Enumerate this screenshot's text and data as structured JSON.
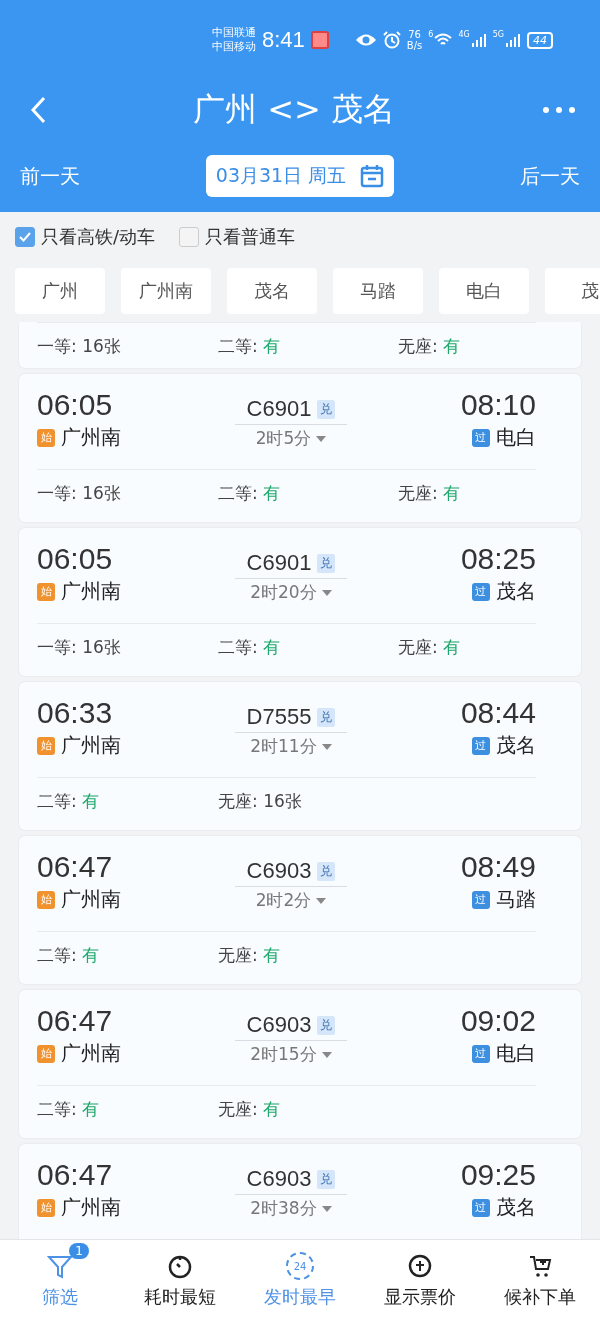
{
  "status_bar": {
    "carriers": [
      "中国联通",
      "中国移动"
    ],
    "time": "8:41",
    "speed": [
      "76",
      "B/s"
    ],
    "wifi_label": "6",
    "signal_labels": [
      "4G",
      "5G"
    ],
    "battery": "44"
  },
  "header": {
    "title": "广州 <> 茂名"
  },
  "date_bar": {
    "prev": "前一天",
    "date": "03月31日 周五",
    "next": "后一天"
  },
  "filters": [
    {
      "label": "只看高铁/动车",
      "checked": true
    },
    {
      "label": "只看普通车",
      "checked": false
    }
  ],
  "stations": [
    "广州",
    "广州南",
    "茂名",
    "马踏",
    "电白",
    "茂"
  ],
  "trains": [
    {
      "seats": [
        {
          "class": "一等: ",
          "value": "16张",
          "ample": false
        },
        {
          "class": "二等: ",
          "value": "有",
          "ample": true
        },
        {
          "class": "无座: ",
          "value": "有",
          "ample": true
        }
      ]
    },
    {
      "depart": "06:05",
      "from_badge": {
        "text": "始",
        "color": "#f0922e"
      },
      "from": "广州南",
      "number": "C6901",
      "tag": "兑",
      "duration": "2时5分",
      "arrive": "08:10",
      "to_badge": {
        "text": "过",
        "color": "#3d8fe0"
      },
      "to": "电白",
      "seats": [
        {
          "class": "一等: ",
          "value": "16张",
          "ample": false
        },
        {
          "class": "二等: ",
          "value": "有",
          "ample": true
        },
        {
          "class": "无座: ",
          "value": "有",
          "ample": true
        }
      ]
    },
    {
      "depart": "06:05",
      "from_badge": {
        "text": "始",
        "color": "#f0922e"
      },
      "from": "广州南",
      "number": "C6901",
      "tag": "兑",
      "duration": "2时20分",
      "arrive": "08:25",
      "to_badge": {
        "text": "过",
        "color": "#3d8fe0"
      },
      "to": "茂名",
      "seats": [
        {
          "class": "一等: ",
          "value": "16张",
          "ample": false
        },
        {
          "class": "二等: ",
          "value": "有",
          "ample": true
        },
        {
          "class": "无座: ",
          "value": "有",
          "ample": true
        }
      ]
    },
    {
      "depart": "06:33",
      "from_badge": {
        "text": "始",
        "color": "#f0922e"
      },
      "from": "广州南",
      "number": "D7555",
      "tag": "兑",
      "duration": "2时11分",
      "arrive": "08:44",
      "to_badge": {
        "text": "过",
        "color": "#3d8fe0"
      },
      "to": "茂名",
      "seats": [
        {
          "class": "二等: ",
          "value": "有",
          "ample": true
        },
        {
          "class": "无座: ",
          "value": "16张",
          "ample": false
        }
      ]
    },
    {
      "depart": "06:47",
      "from_badge": {
        "text": "始",
        "color": "#f0922e"
      },
      "from": "广州南",
      "number": "C6903",
      "tag": "兑",
      "duration": "2时2分",
      "arrive": "08:49",
      "to_badge": {
        "text": "过",
        "color": "#3d8fe0"
      },
      "to": "马踏",
      "seats": [
        {
          "class": "二等: ",
          "value": "有",
          "ample": true
        },
        {
          "class": "无座: ",
          "value": "有",
          "ample": true
        }
      ]
    },
    {
      "depart": "06:47",
      "from_badge": {
        "text": "始",
        "color": "#f0922e"
      },
      "from": "广州南",
      "number": "C6903",
      "tag": "兑",
      "duration": "2时15分",
      "arrive": "09:02",
      "to_badge": {
        "text": "过",
        "color": "#3d8fe0"
      },
      "to": "电白",
      "seats": [
        {
          "class": "二等: ",
          "value": "有",
          "ample": true
        },
        {
          "class": "无座: ",
          "value": "有",
          "ample": true
        }
      ]
    },
    {
      "depart": "06:47",
      "from_badge": {
        "text": "始",
        "color": "#f0922e"
      },
      "from": "广州南",
      "number": "C6903",
      "tag": "兑",
      "duration": "2时38分",
      "arrive": "09:25",
      "to_badge": {
        "text": "过",
        "color": "#3d8fe0"
      },
      "to": "茂名"
    }
  ],
  "bottom_nav": [
    {
      "kind": "filter",
      "label": "筛选",
      "badge": "1",
      "selected": true
    },
    {
      "kind": "timer",
      "label": "耗时最短",
      "selected": false
    },
    {
      "kind": "clock24",
      "label": "发时最早",
      "icon_text": "24",
      "selected": true
    },
    {
      "kind": "price",
      "label": "显示票价",
      "selected": false
    },
    {
      "kind": "cart",
      "label": "候补下单",
      "selected": false
    }
  ]
}
